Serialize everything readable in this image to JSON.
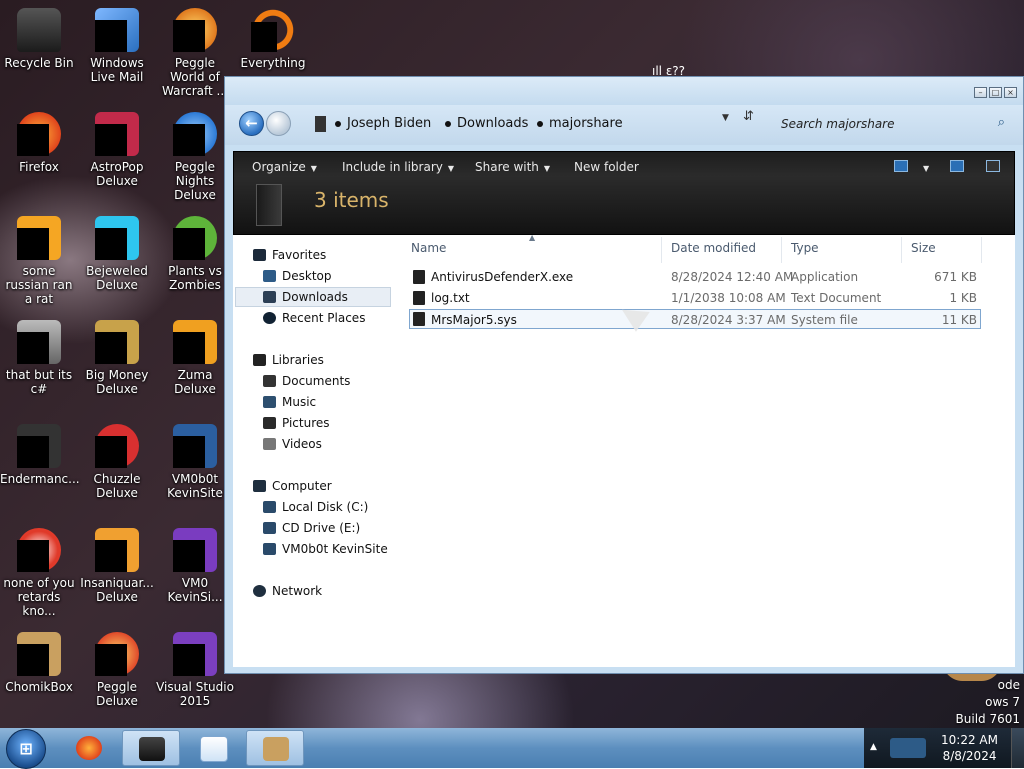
{
  "desktop": {
    "icons": [
      {
        "label": "Recycle Bin",
        "color": "#3a6fbf"
      },
      {
        "label": "Windows Live Mail",
        "color": "#4b8ad6"
      },
      {
        "label": "Peggle World of Warcraft ...",
        "color": "#e07a1f"
      },
      {
        "label": "Everything",
        "color": "#f07c12"
      },
      {
        "label": "Firefox",
        "color": "#f0641c"
      },
      {
        "label": "AstroPop Deluxe",
        "color": "#c22a4a"
      },
      {
        "label": "Peggle Nights Deluxe",
        "color": "#2c7ad6"
      },
      {
        "label": "some russian ran a rat",
        "color": "#f5a623"
      },
      {
        "label": "Bejeweled Deluxe",
        "color": "#2ec6ef"
      },
      {
        "label": "Plants vs Zombies",
        "color": "#5eb43a"
      },
      {
        "label": "that but its c#",
        "color": "#8a8a8a"
      },
      {
        "label": "Big Money Deluxe",
        "color": "#c8a24a"
      },
      {
        "label": "Zuma Deluxe",
        "color": "#f0a020"
      },
      {
        "label": "Endermanc...",
        "color": "#555555"
      },
      {
        "label": "Chuzzle Deluxe",
        "color": "#d83030"
      },
      {
        "label": "VM0b0t KevinSite",
        "color": "#2b5fa0"
      },
      {
        "label": "none of you retards kno...",
        "color": "#e03a2a"
      },
      {
        "label": "Insaniquar... Deluxe",
        "color": "#f0a030"
      },
      {
        "label": "VM0 KevinSi...",
        "color": "#7a3cc0"
      },
      {
        "label": "ChomikBox",
        "color": "#c9a060"
      },
      {
        "label": "Peggle Deluxe",
        "color": "#e04a2a"
      },
      {
        "label": "Visual Studio 2015",
        "color": "#7b3fbf"
      }
    ],
    "scrawl": "ıll ɛ??",
    "watermark": [
      "ode",
      "ows 7",
      "Build 7601"
    ]
  },
  "window": {
    "breadcrumb": [
      "Joseph Biden",
      "Downloads",
      "majorshare"
    ],
    "search_placeholder": "Search majorshare",
    "toolbar": {
      "organize": "Organize",
      "include": "Include in library",
      "share": "Share with",
      "newfolder": "New folder"
    },
    "items_count": "3 items",
    "nav": {
      "favorites": "Favorites",
      "desktop": "Desktop",
      "downloads": "Downloads",
      "recent": "Recent Places",
      "libraries": "Libraries",
      "documents": "Documents",
      "music": "Music",
      "pictures": "Pictures",
      "videos": "Videos",
      "computer": "Computer",
      "localdisk": "Local Disk (C:)",
      "cddrive": "CD Drive (E:)",
      "vmkevin": "VM0b0t KevinSite",
      "network": "Network"
    },
    "columns": {
      "name": "Name",
      "date": "Date modified",
      "type": "Type",
      "size": "Size"
    },
    "files": [
      {
        "name": "AntivirusDefenderX.exe",
        "date": "8/28/2024 12:40 AM",
        "type": "Application",
        "size": "671 KB"
      },
      {
        "name": "log.txt",
        "date": "1/1/2038 10:08 AM",
        "type": "Text Document",
        "size": "1 KB"
      },
      {
        "name": "MrsMajor5.sys",
        "date": "8/28/2024 3:37 AM",
        "type": "System file",
        "size": "11 KB"
      }
    ]
  },
  "taskbar": {
    "time": "10:22 AM",
    "date": "8/8/2024"
  }
}
